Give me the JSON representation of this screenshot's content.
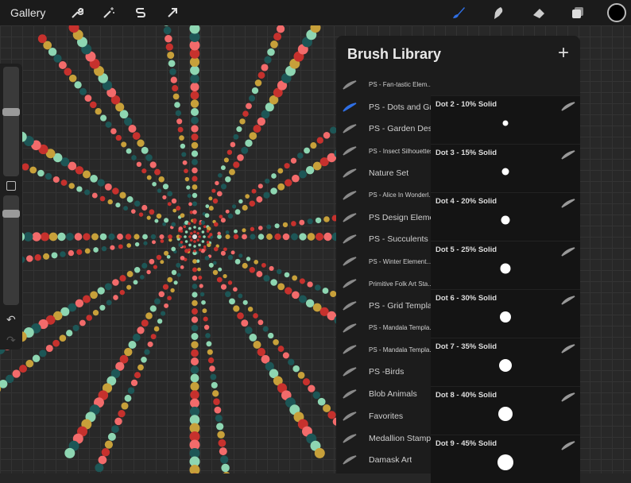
{
  "topbar": {
    "gallery": "Gallery",
    "tools": [
      "wrench-icon",
      "magic-wand-icon",
      "selection-s-icon",
      "transform-arrow-icon"
    ],
    "right_tools": [
      "brush-icon",
      "smudge-icon",
      "eraser-icon",
      "layers-icon"
    ],
    "current_color": "#000000",
    "accent": "#2f6fe4"
  },
  "panel": {
    "title": "Brush Library",
    "add": "+"
  },
  "brush_sets": [
    {
      "label": "PS - Fan-tastic Elem...",
      "small": true
    },
    {
      "label": "PS - Dots and Grids",
      "selected": true
    },
    {
      "label": "PS - Garden Designs"
    },
    {
      "label": "PS - Insect Silhouettes",
      "small": true
    },
    {
      "label": "Nature Set"
    },
    {
      "label": "PS - Alice In Wonderl...",
      "small": true
    },
    {
      "label": "PS Design Elements"
    },
    {
      "label": "PS - Succulents"
    },
    {
      "label": "PS - Winter Element...",
      "small": true
    },
    {
      "label": "Primitive Folk Art Sta...",
      "small": true
    },
    {
      "label": "PS - Grid Templates"
    },
    {
      "label": "PS - Mandala Templa...",
      "small": true
    },
    {
      "label": "PS - Mandala Templa...",
      "small": true
    },
    {
      "label": "PS -Birds"
    },
    {
      "label": "Blob Animals"
    },
    {
      "label": "Favorites"
    },
    {
      "label": "Medallion Stamps"
    },
    {
      "label": "Damask Art"
    }
  ],
  "brushes": [
    {
      "name": "Dot 2 - 10% Solid",
      "size": 0.1
    },
    {
      "name": "Dot 3 - 15% Solid",
      "size": 0.15
    },
    {
      "name": "Dot 4 - 20% Solid",
      "size": 0.2
    },
    {
      "name": "Dot 5 - 25% Solid",
      "size": 0.25
    },
    {
      "name": "Dot 6 - 30% Solid",
      "size": 0.3
    },
    {
      "name": "Dot 7 - 35% Solid",
      "size": 0.35
    },
    {
      "name": "Dot 8 - 40% Solid",
      "size": 0.4
    },
    {
      "name": "Dot 9 - 45% Solid",
      "size": 0.45
    }
  ],
  "palette": [
    "#f26b6b",
    "#1d5656",
    "#8ed6b2",
    "#c7a03a",
    "#c6312d"
  ]
}
